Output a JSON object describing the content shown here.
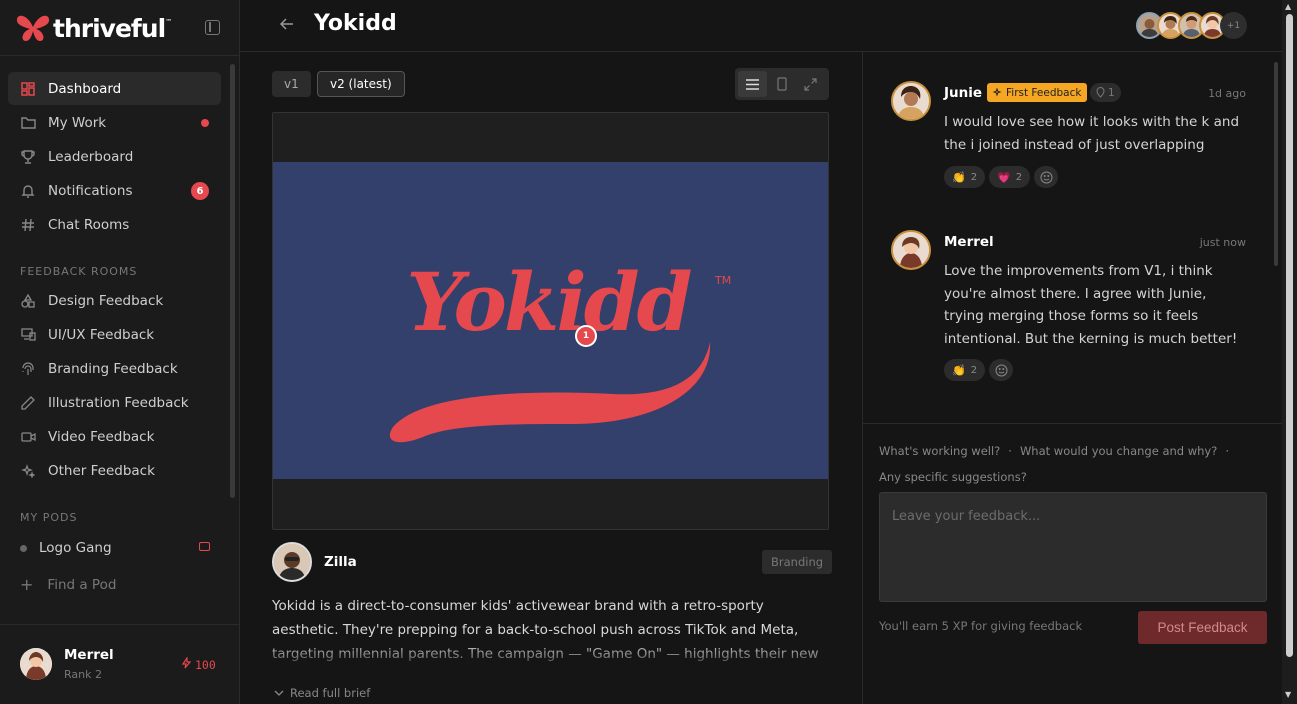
{
  "brand": {
    "name": "thriveful",
    "tm": "™"
  },
  "sidebar": {
    "nav": [
      {
        "label": "Dashboard",
        "icon": "dashboard-icon",
        "active": true
      },
      {
        "label": "My Work",
        "icon": "folder-icon",
        "dot": true
      },
      {
        "label": "Leaderboard",
        "icon": "trophy-icon"
      },
      {
        "label": "Notifications",
        "icon": "bell-icon",
        "count": "6"
      },
      {
        "label": "Chat Rooms",
        "icon": "hash-icon"
      }
    ],
    "feedback_rooms_label": "FEEDBACK ROOMS",
    "rooms": [
      {
        "label": "Design Feedback",
        "icon": "shapes-icon"
      },
      {
        "label": "UI/UX Feedback",
        "icon": "devices-icon"
      },
      {
        "label": "Branding Feedback",
        "icon": "fingerprint-icon"
      },
      {
        "label": "Illustration Feedback",
        "icon": "pencil-icon"
      },
      {
        "label": "Video Feedback",
        "icon": "video-icon"
      },
      {
        "label": "Other Feedback",
        "icon": "sparkles-icon"
      }
    ],
    "my_pods_label": "MY PODS",
    "pods": [
      {
        "label": "Logo Gang"
      }
    ],
    "find_pod": "Find a Pod",
    "user": {
      "name": "Merrel",
      "rank": "Rank 2",
      "xp": "100"
    }
  },
  "header": {
    "title": "Yokidd",
    "extra_members": "+1"
  },
  "main": {
    "versions": [
      "v1",
      "v2 (latest)"
    ],
    "artwork": {
      "wordmark": "Yokidd",
      "tm": "TM",
      "background": "#32406b",
      "ink": "#e5484d"
    },
    "pin_number": "1",
    "author": "Zilla",
    "tag": "Branding",
    "brief": "Yokidd is a direct-to-consumer kids' activewear brand with a retro-sporty aesthetic. They're prepping for a back-to-school push across TikTok and Meta, targeting millennial parents. The campaign — \"Game On\" — highlights their new moisture-",
    "read_more": "Read full brief"
  },
  "comments": [
    {
      "name": "Junie",
      "badge": "First Feedback",
      "pins": "1",
      "time": "1d ago",
      "text": "I would love see how it looks with the k and the i joined instead of just overlapping",
      "reactions": [
        {
          "emoji": "👏",
          "count": "2"
        },
        {
          "emoji": "💗",
          "count": "2"
        }
      ]
    },
    {
      "name": "Merrel",
      "time": "just now",
      "text": "Love the improvements from V1, i think you're almost there. I agree with Junie, trying merging those forms so it feels intentional. But the kerning is much better!",
      "reactions": [
        {
          "emoji": "👏",
          "count": "2"
        }
      ]
    }
  ],
  "composer": {
    "prompt_1": "What's working well?",
    "prompt_2": "What would you change and why?",
    "prompt_3": "Any specific suggestions?",
    "separator": "·",
    "placeholder": "Leave your feedback...",
    "xp_note": "You'll earn 5 XP for giving feedback",
    "post_label": "Post Feedback"
  },
  "colors": {
    "accent": "#e5484d",
    "gold": "#f5a623",
    "bg": "#151515"
  }
}
